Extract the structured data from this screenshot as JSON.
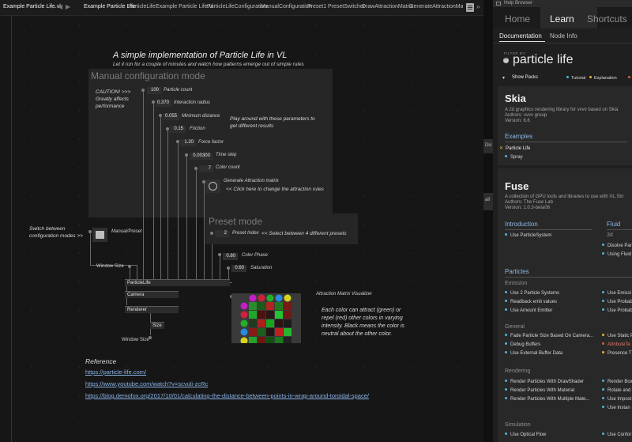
{
  "tabbar": {
    "file_tab": "Example Particle Life.vl",
    "tabs": [
      "Example Particle Life",
      "ParticleLife",
      "Example Particle Life.vl",
      "ParticleLifeConfiguration",
      "ManualConfiguration",
      "Preset1",
      "PresetSwitcher",
      "DrawAttractionMatrix",
      "GenerateAttractionMatrix"
    ]
  },
  "patch": {
    "title": "A simple implementation of Particle Life in VL",
    "subtitle": "Let it run for a couple of minutes and watch how patterns emerge out of simple rules",
    "manual": {
      "title": "Manual configuration mode",
      "caution": [
        "CAUTION! >>>",
        "Greatly affects",
        "performance"
      ],
      "note": [
        "Play around with these parameters to",
        "get different results"
      ],
      "params": [
        {
          "value": "100",
          "label": "Particle count"
        },
        {
          "value": "0.370",
          "label": "Interaction radius"
        },
        {
          "value": "0.055",
          "label": "Minimum distance"
        },
        {
          "value": "0.15",
          "label": "Friction"
        },
        {
          "value": "1.20",
          "label": "Force factor"
        },
        {
          "value": "0.00300",
          "label": "Time step"
        },
        {
          "value": "7",
          "label": "Color count"
        }
      ],
      "generate_label": "Generate Attraction matrix",
      "generate_hint": "<< Click here to change the attraction rules"
    },
    "preset": {
      "title": "Preset mode",
      "index_value": "2",
      "index_label": "Preset Index",
      "index_hint": "<< Select between 4 different presets",
      "color_phase_value": "0.80",
      "color_phase_label": "Color Phase",
      "saturation_value": "0.60",
      "saturation_label": "Saturation"
    },
    "switch_note": [
      "Switch between",
      "configuration modes >>"
    ],
    "manual_preset_label": "Manual/Preset",
    "window_size_label": "Window Size",
    "window_size_label2": "Window Size",
    "nodes": {
      "particlelife": "ParticleLife",
      "camera": "Camera",
      "renderer": "Renderer",
      "size": "Size"
    },
    "matrix_label": "Attraction Matrix Visualizer",
    "matrix_note": [
      "Each color can attract (green) or",
      "repel (red) other colors in varying",
      "intensity. Black means the color is",
      "neutral about the other color."
    ],
    "matrix_colors": [
      "#c21fc9",
      "#d1203a",
      "#22b02a",
      "#2a8be0",
      "#d8d21f"
    ],
    "reference_title": "Reference",
    "links": [
      "https://particle-life.com/",
      "https://www.youtube.com/watch?v=scvuli-zcRc",
      "https://blog.demofox.org/2017/10/01/calculating-the-distance-between-points-in-wrap-around-toroidal-space/"
    ]
  },
  "strip": {
    "t1": "Dic",
    "t2": "all"
  },
  "help": {
    "window_title": "Help Browser",
    "tabs": [
      "Home",
      "Learn",
      "Shortcuts"
    ],
    "subtabs": [
      "Documentation",
      "Node Info"
    ],
    "filter_label": "FILTER BY:",
    "search": "particle life",
    "show_packs": "Show Packs",
    "legend": [
      {
        "label": "Tutorial",
        "color": "#4fb3e0"
      },
      {
        "label": "Explanation",
        "color": "#e5b33a"
      }
    ],
    "skia": {
      "title": "Skia",
      "desc": "A 2d graphics rendering library for vvvv based on Skia",
      "authors": "Authors: vvvv group",
      "version": "Version: 6.6",
      "examples_label": "Examples",
      "items": [
        "Particle Life",
        "Spray"
      ]
    },
    "fuse": {
      "title": "Fuse",
      "desc": "A collection of GPU tools and libraries to use with VL.Stri",
      "authors": "Authors: The Fuse Lab",
      "version": "Version: 1.0.3-beta06",
      "intro_label": "Introduction",
      "fluid_label": "Fluid",
      "fluid_sub": "3d",
      "intro_items": [
        "Use ParticleSystem"
      ],
      "fluid_items": [
        "Disolve Par",
        "Using Fluid"
      ],
      "particles_label": "Particles",
      "emission_label": "Emission",
      "emission_items": [
        "Use 2 Particle Systems",
        "Readback emit values",
        "Use Amount Emitter"
      ],
      "emission_right": [
        "Use Emissi",
        "Use Probab",
        "Use Probab"
      ],
      "general_label": "General",
      "general_items": [
        "Fade Particle Size Based On Camera...",
        "Debug Buffers",
        "Use External Buffer Data"
      ],
      "general_right": [
        "Use Static P",
        "AttributeTe",
        "Presence T"
      ],
      "rendering_label": "Rendering",
      "rendering_items": [
        "Render Particles With DrawShader",
        "Render Particles With Material",
        "Render Particles With Multiple Mate..."
      ],
      "rendering_right": [
        "Render Box",
        "Rotate and",
        "Use Impost",
        "Use Instan"
      ],
      "simulation_label": "Simulation",
      "simulation_items": [
        "Use Optical Flow"
      ],
      "simulation_right": [
        "Use Confor"
      ]
    }
  }
}
